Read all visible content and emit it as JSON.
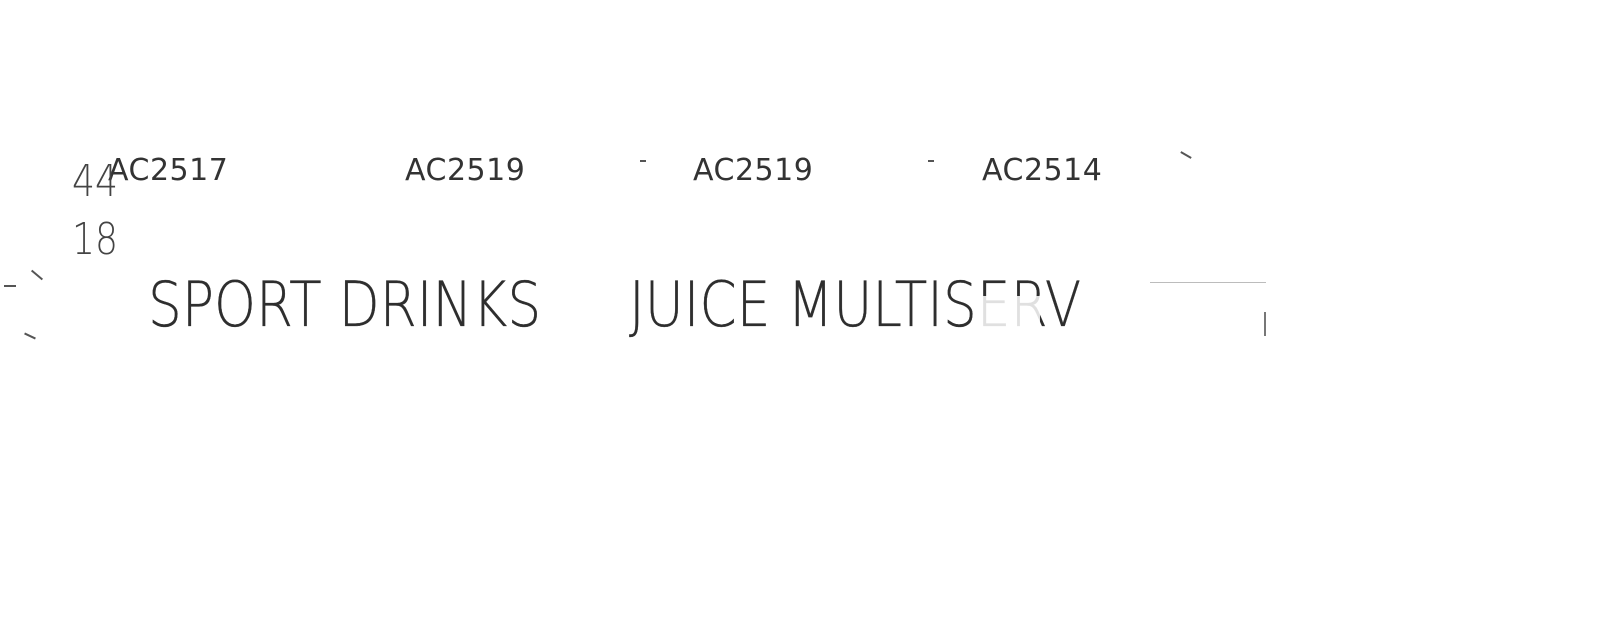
{
  "codes": [
    "AC2517",
    "AC2519",
    "AC2519",
    "AC2514"
  ],
  "numbers": {
    "top": "44",
    "bottom": "18"
  },
  "labels": {
    "sport_drinks": "SPORT DRINKS",
    "juice_multiserv": "JUICE MULTISERV"
  }
}
